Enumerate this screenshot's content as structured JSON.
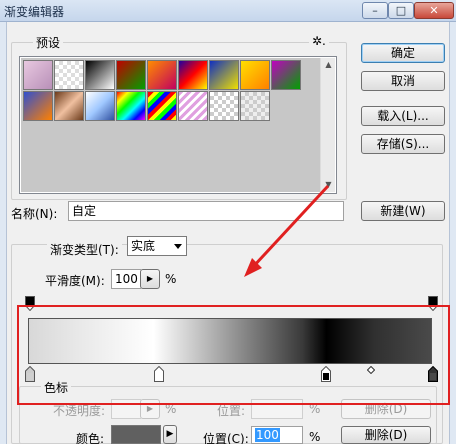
{
  "window": {
    "title": "渐变编辑器",
    "controls": {
      "minimize": "–",
      "maximize": "□",
      "close": "✕"
    }
  },
  "presets": {
    "label": "预设",
    "menu_glyph": "✲."
  },
  "buttons": {
    "ok": "确定",
    "cancel": "取消",
    "load": "载入(L)...",
    "save": "存储(S)...",
    "new": "新建(W)",
    "delete_opacity": "删除(D)",
    "delete_color": "删除(D)"
  },
  "name": {
    "label": "名称(N):",
    "value": "自定"
  },
  "gradient": {
    "type_label": "渐变类型(T):",
    "type_value": "实底",
    "smooth_label": "平滑度(M):",
    "smooth_value": "100",
    "smooth_unit": "%"
  },
  "stops": {
    "group_label": "色标",
    "opacity_label": "不透明度:",
    "opacity_unit": "%",
    "location_label": "位置:",
    "location_unit": "%",
    "color_label": "颜色:",
    "color_location_label": "位置(C):",
    "color_location_value": "100",
    "color_location_unit": "%"
  },
  "colors": {
    "annotation": "#e02020",
    "selection": "#3399ff",
    "color_swatch": "#606060"
  },
  "annotation_icon": "red-arrow-icon"
}
